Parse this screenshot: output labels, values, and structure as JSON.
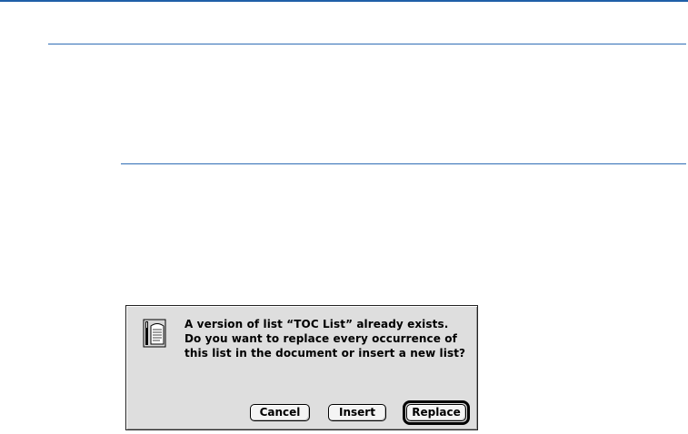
{
  "dialog": {
    "icon": "caution-document-icon",
    "message": "A version of list “TOC List” already exists. Do you want to replace every occurrence of this list in the document or insert a new list?",
    "buttons": {
      "cancel": "Cancel",
      "insert": "Insert",
      "replace": "Replace"
    },
    "default_button": "Replace"
  }
}
